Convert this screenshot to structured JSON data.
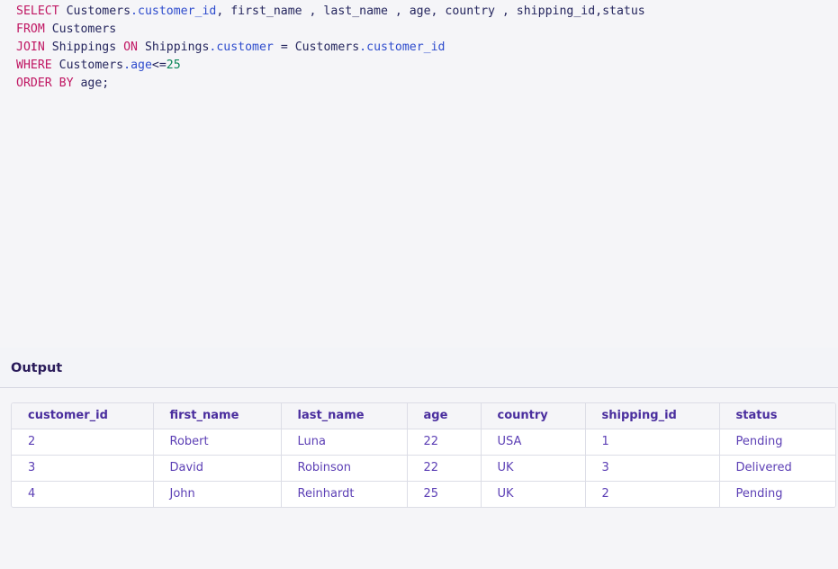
{
  "editor": {
    "lines": [
      [
        {
          "t": "SELECT",
          "c": "kw"
        },
        {
          "t": " Customers",
          "c": ""
        },
        {
          "t": ".",
          "c": "op"
        },
        {
          "t": "customer_id",
          "c": "prop"
        },
        {
          "t": ", first_name , last_name , age, country , shipping_id,status",
          "c": ""
        }
      ],
      [
        {
          "t": "FROM",
          "c": "kw"
        },
        {
          "t": " Customers",
          "c": ""
        }
      ],
      [
        {
          "t": "JOIN",
          "c": "kw"
        },
        {
          "t": " Shippings ",
          "c": ""
        },
        {
          "t": "ON",
          "c": "kw"
        },
        {
          "t": " Shippings",
          "c": ""
        },
        {
          "t": ".",
          "c": "op"
        },
        {
          "t": "customer",
          "c": "prop"
        },
        {
          "t": " = Customers",
          "c": ""
        },
        {
          "t": ".",
          "c": "op"
        },
        {
          "t": "customer_id",
          "c": "prop"
        }
      ],
      [
        {
          "t": "WHERE",
          "c": "kw"
        },
        {
          "t": " Customers",
          "c": ""
        },
        {
          "t": ".",
          "c": "op"
        },
        {
          "t": "age",
          "c": "prop"
        },
        {
          "t": "<=",
          "c": ""
        },
        {
          "t": "25",
          "c": "num"
        }
      ],
      [
        {
          "t": "ORDER BY",
          "c": "kw"
        },
        {
          "t": " age;",
          "c": ""
        }
      ]
    ]
  },
  "output": {
    "title": "Output",
    "columns": [
      "customer_id",
      "first_name",
      "last_name",
      "age",
      "country",
      "shipping_id",
      "status"
    ],
    "rows": [
      [
        "2",
        "Robert",
        "Luna",
        "22",
        "USA",
        "1",
        "Pending"
      ],
      [
        "3",
        "David",
        "Robinson",
        "22",
        "UK",
        "3",
        "Delivered"
      ],
      [
        "4",
        "John",
        "Reinhardt",
        "25",
        "UK",
        "2",
        "Pending"
      ]
    ]
  }
}
